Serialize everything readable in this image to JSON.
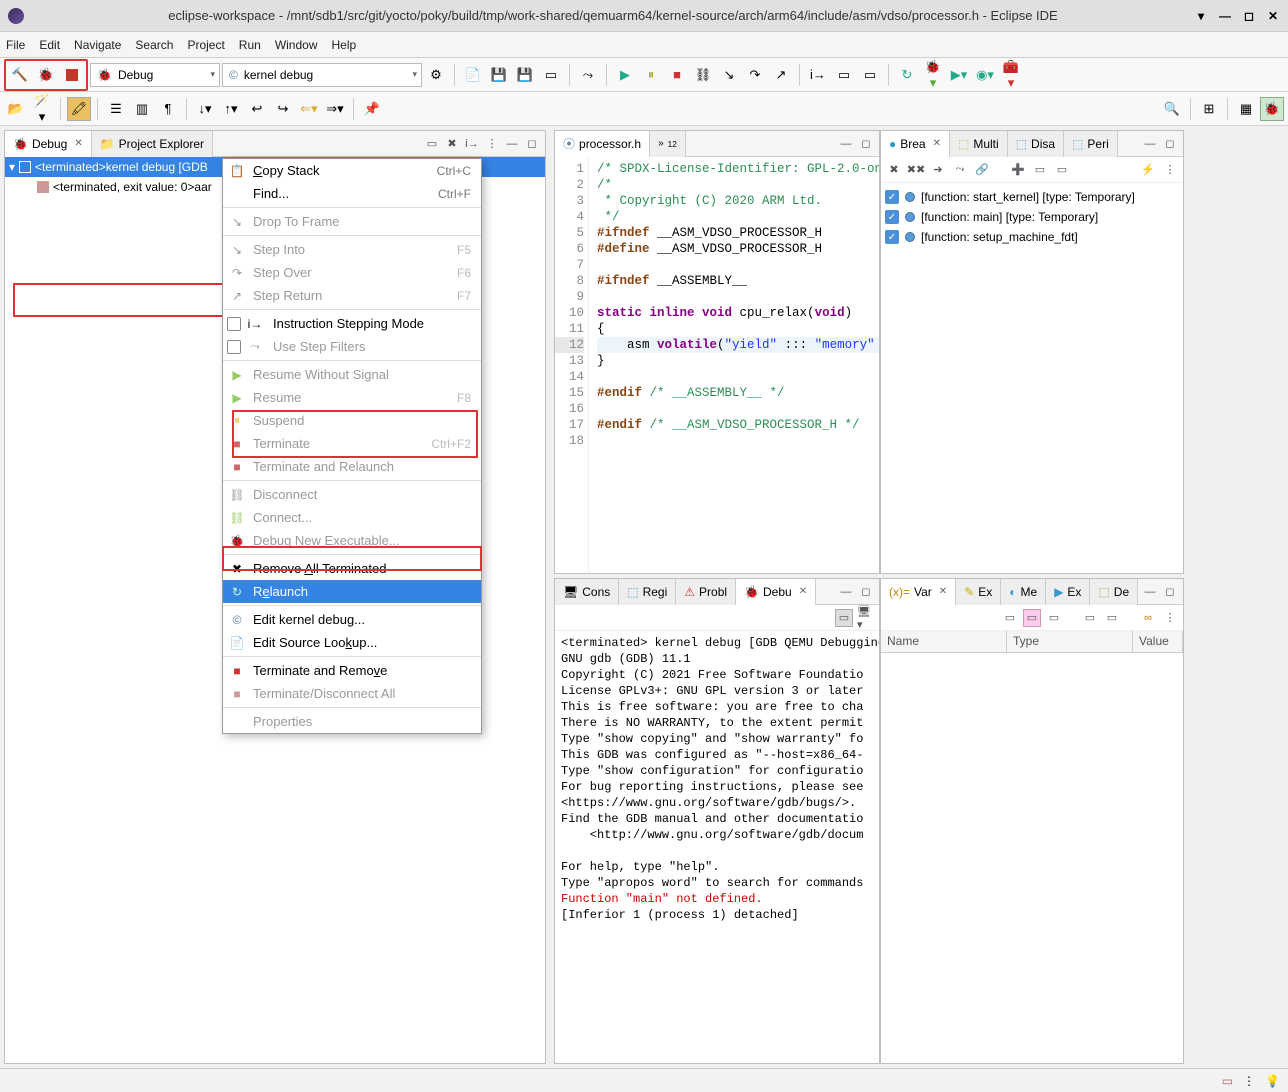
{
  "window": {
    "title": "eclipse-workspace - /mnt/sdb1/src/git/yocto/poky/build/tmp/work-shared/qemuarm64/kernel-source/arch/arm64/include/asm/vdso/processor.h - Eclipse IDE"
  },
  "menu": [
    "File",
    "Edit",
    "Navigate",
    "Search",
    "Project",
    "Run",
    "Window",
    "Help"
  ],
  "toolbar": {
    "debug_combo": "Debug",
    "config_combo": "kernel debug"
  },
  "debug_view": {
    "tab_debug": "Debug",
    "tab_project": "Project Explorer",
    "items": [
      "<terminated>kernel debug [GDB",
      "<terminated, exit value: 0>aar"
    ]
  },
  "context_menu": {
    "copy_stack": "Copy Stack",
    "copy_stack_sc": "Ctrl+C",
    "find": "Find...",
    "find_sc": "Ctrl+F",
    "drop": "Drop To Frame",
    "step_into": "Step Into",
    "step_into_sc": "F5",
    "step_over": "Step Over",
    "step_over_sc": "F6",
    "step_return": "Step Return",
    "step_return_sc": "F7",
    "instr": "Instruction Stepping Mode",
    "use_filters": "Use Step Filters",
    "resume_no_sig": "Resume Without Signal",
    "resume": "Resume",
    "resume_sc": "F8",
    "suspend": "Suspend",
    "terminate": "Terminate",
    "terminate_sc": "Ctrl+F2",
    "term_relaunch": "Terminate and Relaunch",
    "disconnect": "Disconnect",
    "connect": "Connect...",
    "debug_new": "Debug New Executable...",
    "remove_all": "Remove All Terminated",
    "relaunch": "Relaunch",
    "edit_kernel": "Edit kernel debug...",
    "edit_source": "Edit Source Lookup...",
    "term_remove": "Terminate and Remove",
    "term_disc": "Terminate/Disconnect All",
    "properties": "Properties"
  },
  "editor": {
    "tab": "processor.h",
    "lines": {
      "l1": "/* SPDX-License-Identifier: GPL-2.0-on",
      "l2": "/*",
      "l3": " * Copyright (C) 2020 ARM Ltd.",
      "l4": " */",
      "l5a": "#ifndef",
      "l5b": " __ASM_VDSO_PROCESSOR_H",
      "l6a": "#define",
      "l6b": " __ASM_VDSO_PROCESSOR_H",
      "l8a": "#ifndef",
      "l8b": " __ASSEMBLY__",
      "l10_static": "static ",
      "l10_inline": "inline ",
      "l10_void1": "void ",
      "l10_fn": "cpu_relax(",
      "l10_void2": "void",
      "l10_end": ")",
      "l11": "{",
      "l12a": "    asm ",
      "l12b": "volatile",
      "l12c": "(",
      "l12d": "\"yield\"",
      "l12e": " ::: ",
      "l12f": "\"memory\"",
      "l13": "}",
      "l15a": "#endif",
      "l15b": " /* __ASSEMBLY__ */",
      "l17a": "#endif",
      "l17b": " /* __ASM_VDSO_PROCESSOR_H */"
    }
  },
  "breakpoints": {
    "tab": "Brea",
    "tab_multi": "Multi",
    "tab_disa": "Disa",
    "tab_peri": "Peri",
    "items": [
      "[function: start_kernel] [type: Temporary]",
      "[function: main] [type: Temporary]",
      "[function: setup_machine_fdt]"
    ]
  },
  "console": {
    "tabs": [
      "Cons",
      "Regi",
      "Probl",
      "Debu"
    ],
    "text": "<terminated> kernel debug [GDB QEMU Debugging] /hom\nGNU gdb (GDB) 11.1\nCopyright (C) 2021 Free Software Foundatio\nLicense GPLv3+: GNU GPL version 3 or later\nThis is free software: you are free to cha\nThere is NO WARRANTY, to the extent permit\nType \"show copying\" and \"show warranty\" fo\nThis GDB was configured as \"--host=x86_64-\nType \"show configuration\" for configuratio\nFor bug reporting instructions, please see\n<https://www.gnu.org/software/gdb/bugs/>.\nFind the GDB manual and other documentatio\n    <http://www.gnu.org/software/gdb/docum\n\nFor help, type \"help\".\nType \"apropos word\" to search for commands",
    "err": "Function \"main\" not defined.",
    "text2": "[Inferior 1 (process 1) detached]"
  },
  "variables": {
    "tabs": [
      "Var",
      "Ex",
      "Me",
      "Ex",
      "De"
    ],
    "cols": [
      "Name",
      "Type",
      "Value"
    ]
  }
}
